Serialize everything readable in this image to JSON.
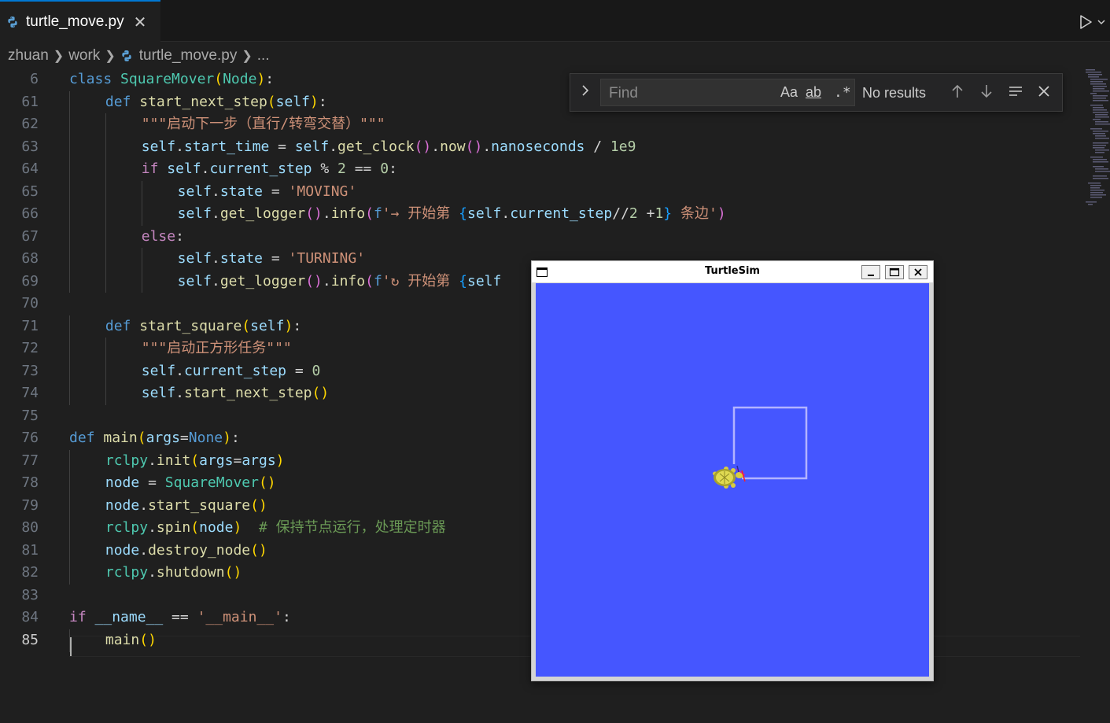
{
  "tab": {
    "filename": "turtle_move.py",
    "close_glyph": "✕"
  },
  "breadcrumb": {
    "parts": [
      "zhuan",
      "work",
      "turtle_move.py",
      "..."
    ]
  },
  "find": {
    "placeholder": "Find",
    "match_case": "Aa",
    "whole_word": "ab",
    "regex": ".*",
    "status": "No results"
  },
  "turtlesim": {
    "title": "TurtleSim",
    "background": "#4556ff",
    "path_color": "#b3b3ff"
  },
  "editor": {
    "active_line": "85",
    "lines": [
      {
        "n": "6",
        "i": 0,
        "t": [
          [
            "class ",
            "kw"
          ],
          [
            "SquareMover",
            "cls"
          ],
          [
            "(",
            "p1"
          ],
          [
            "Node",
            "cls"
          ],
          [
            ")",
            "p1"
          ],
          [
            ":",
            "op"
          ]
        ]
      },
      {
        "n": "61",
        "i": 1,
        "t": [
          [
            "def ",
            "kw"
          ],
          [
            "start_next_step",
            "fn"
          ],
          [
            "(",
            "p1"
          ],
          [
            "self",
            "self"
          ],
          [
            ")",
            "p1"
          ],
          [
            ":",
            "op"
          ]
        ]
      },
      {
        "n": "62",
        "i": 2,
        "t": [
          [
            "\"\"\"启动下一步（直行/转弯交替）\"\"\"",
            "str"
          ]
        ]
      },
      {
        "n": "63",
        "i": 2,
        "t": [
          [
            "self",
            "self"
          ],
          [
            ".",
            "op"
          ],
          [
            "start_time",
            "var"
          ],
          [
            " = ",
            "op"
          ],
          [
            "self",
            "self"
          ],
          [
            ".",
            "op"
          ],
          [
            "get_clock",
            "fn"
          ],
          [
            "()",
            "p2"
          ],
          [
            ".",
            "op"
          ],
          [
            "now",
            "fn"
          ],
          [
            "()",
            "p2"
          ],
          [
            ".",
            "op"
          ],
          [
            "nanoseconds",
            "var"
          ],
          [
            " / ",
            "op"
          ],
          [
            "1e9",
            "num"
          ]
        ]
      },
      {
        "n": "64",
        "i": 2,
        "t": [
          [
            "if ",
            "kw2"
          ],
          [
            "self",
            "self"
          ],
          [
            ".",
            "op"
          ],
          [
            "current_step",
            "var"
          ],
          [
            " % ",
            "op"
          ],
          [
            "2",
            "num"
          ],
          [
            " == ",
            "op"
          ],
          [
            "0",
            "num"
          ],
          [
            ":",
            "op"
          ]
        ]
      },
      {
        "n": "65",
        "i": 3,
        "t": [
          [
            "self",
            "self"
          ],
          [
            ".",
            "op"
          ],
          [
            "state",
            "var"
          ],
          [
            " = ",
            "op"
          ],
          [
            "'MOVING'",
            "str"
          ]
        ]
      },
      {
        "n": "66",
        "i": 3,
        "t": [
          [
            "self",
            "self"
          ],
          [
            ".",
            "op"
          ],
          [
            "get_logger",
            "fn"
          ],
          [
            "()",
            "p2"
          ],
          [
            ".",
            "op"
          ],
          [
            "info",
            "fn"
          ],
          [
            "(",
            "p2"
          ],
          [
            "f",
            "kw"
          ],
          [
            "'→ 开始第 ",
            "str"
          ],
          [
            "{",
            "p3"
          ],
          [
            "self",
            "self"
          ],
          [
            ".",
            "op"
          ],
          [
            "current_step",
            "var"
          ],
          [
            "//",
            "op"
          ],
          [
            "2",
            "num"
          ],
          [
            " +",
            "op"
          ],
          [
            "1",
            "num"
          ],
          [
            "}",
            "p3"
          ],
          [
            " 条边'",
            "str"
          ],
          [
            ")",
            "p2"
          ]
        ]
      },
      {
        "n": "67",
        "i": 2,
        "t": [
          [
            "else",
            "kw2"
          ],
          [
            ":",
            "op"
          ]
        ]
      },
      {
        "n": "68",
        "i": 3,
        "t": [
          [
            "self",
            "self"
          ],
          [
            ".",
            "op"
          ],
          [
            "state",
            "var"
          ],
          [
            " = ",
            "op"
          ],
          [
            "'TURNING'",
            "str"
          ]
        ]
      },
      {
        "n": "69",
        "i": 3,
        "t": [
          [
            "self",
            "self"
          ],
          [
            ".",
            "op"
          ],
          [
            "get_logger",
            "fn"
          ],
          [
            "()",
            "p2"
          ],
          [
            ".",
            "op"
          ],
          [
            "info",
            "fn"
          ],
          [
            "(",
            "p2"
          ],
          [
            "f",
            "kw"
          ],
          [
            "'↻ 开始第 ",
            "str"
          ],
          [
            "{",
            "p3"
          ],
          [
            "self",
            "self"
          ]
        ]
      },
      {
        "n": "70",
        "i": 0,
        "t": []
      },
      {
        "n": "71",
        "i": 1,
        "t": [
          [
            "def ",
            "kw"
          ],
          [
            "start_square",
            "fn"
          ],
          [
            "(",
            "p1"
          ],
          [
            "self",
            "self"
          ],
          [
            ")",
            "p1"
          ],
          [
            ":",
            "op"
          ]
        ]
      },
      {
        "n": "72",
        "i": 2,
        "t": [
          [
            "\"\"\"启动正方形任务\"\"\"",
            "str"
          ]
        ]
      },
      {
        "n": "73",
        "i": 2,
        "t": [
          [
            "self",
            "self"
          ],
          [
            ".",
            "op"
          ],
          [
            "current_step",
            "var"
          ],
          [
            " = ",
            "op"
          ],
          [
            "0",
            "num"
          ]
        ]
      },
      {
        "n": "74",
        "i": 2,
        "t": [
          [
            "self",
            "self"
          ],
          [
            ".",
            "op"
          ],
          [
            "start_next_step",
            "fn"
          ],
          [
            "()",
            "p1"
          ]
        ]
      },
      {
        "n": "75",
        "i": 0,
        "t": []
      },
      {
        "n": "76",
        "i": 0,
        "t": [
          [
            "def ",
            "kw"
          ],
          [
            "main",
            "fn"
          ],
          [
            "(",
            "p1"
          ],
          [
            "args",
            "var"
          ],
          [
            "=",
            "op"
          ],
          [
            "None",
            "kw"
          ],
          [
            ")",
            "p1"
          ],
          [
            ":",
            "op"
          ]
        ]
      },
      {
        "n": "77",
        "i": 1,
        "t": [
          [
            "rclpy",
            "cls"
          ],
          [
            ".",
            "op"
          ],
          [
            "init",
            "fn"
          ],
          [
            "(",
            "p1"
          ],
          [
            "args",
            "var"
          ],
          [
            "=",
            "op"
          ],
          [
            "args",
            "var"
          ],
          [
            ")",
            "p1"
          ]
        ]
      },
      {
        "n": "78",
        "i": 1,
        "t": [
          [
            "node",
            "var"
          ],
          [
            " = ",
            "op"
          ],
          [
            "SquareMover",
            "cls"
          ],
          [
            "()",
            "p1"
          ]
        ]
      },
      {
        "n": "79",
        "i": 1,
        "t": [
          [
            "node",
            "var"
          ],
          [
            ".",
            "op"
          ],
          [
            "start_square",
            "fn"
          ],
          [
            "()",
            "p1"
          ]
        ]
      },
      {
        "n": "80",
        "i": 1,
        "t": [
          [
            "rclpy",
            "cls"
          ],
          [
            ".",
            "op"
          ],
          [
            "spin",
            "fn"
          ],
          [
            "(",
            "p1"
          ],
          [
            "node",
            "var"
          ],
          [
            ")",
            "p1"
          ],
          [
            "  # 保持节点运行，处理定时器",
            "cmt"
          ]
        ]
      },
      {
        "n": "81",
        "i": 1,
        "t": [
          [
            "node",
            "var"
          ],
          [
            ".",
            "op"
          ],
          [
            "destroy_node",
            "fn"
          ],
          [
            "()",
            "p1"
          ]
        ]
      },
      {
        "n": "82",
        "i": 1,
        "t": [
          [
            "rclpy",
            "cls"
          ],
          [
            ".",
            "op"
          ],
          [
            "shutdown",
            "fn"
          ],
          [
            "()",
            "p1"
          ]
        ]
      },
      {
        "n": "83",
        "i": 0,
        "t": []
      },
      {
        "n": "84",
        "i": 0,
        "t": [
          [
            "if ",
            "kw2"
          ],
          [
            "__name__",
            "var"
          ],
          [
            " == ",
            "op"
          ],
          [
            "'__main__'",
            "str"
          ],
          [
            ":",
            "op"
          ]
        ]
      },
      {
        "n": "85",
        "i": 1,
        "t": [
          [
            "main",
            "fn"
          ],
          [
            "()",
            "p1"
          ]
        ]
      }
    ]
  }
}
